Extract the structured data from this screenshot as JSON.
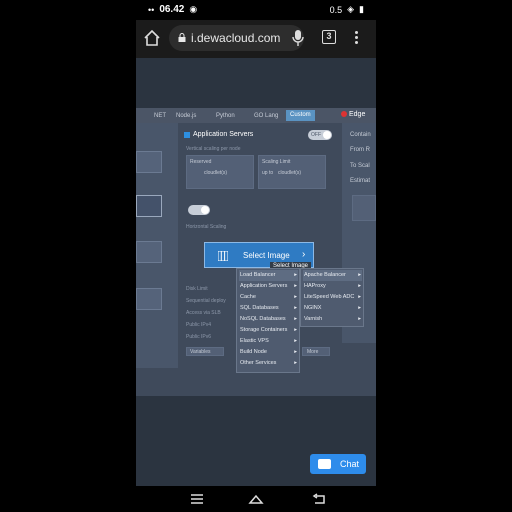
{
  "status": {
    "left_icons": "••",
    "time": "06.42",
    "right_text": "0.5"
  },
  "browser": {
    "url": "i.dewacloud.com",
    "tab_count": "3"
  },
  "stack_tabs": [
    "NET",
    "Node.js",
    "Python",
    "GO Lang",
    "Custom"
  ],
  "edge_label": "Edge",
  "panel": {
    "title": "Application Servers",
    "toggle": "OFF",
    "scaling_label": "Vertical scaling per node",
    "reserved": "Reserved",
    "scaling_limit": "Scaling Limit",
    "up_to": "up to",
    "cloudlets1": "cloudlet(s)",
    "cloudlets2": "cloudlet(s)",
    "horizontal": "Horizontal Scaling",
    "disk_limit": "Disk Limit",
    "seq_deploy": "Sequential deploy",
    "access_slb": "Access via SLB",
    "public_ipv4": "Public IPv4",
    "public_ipv6": "Public IPv6",
    "variables": "Variables",
    "more": "More"
  },
  "right_panel": [
    "Contain",
    "From R",
    "To Scal",
    "Estimat"
  ],
  "select_image": {
    "label": "Select Image",
    "tooltip": "Select Image"
  },
  "menu1": [
    "Load Balancer",
    "Application Servers",
    "Cache",
    "SQL Databases",
    "NoSQL Databases",
    "Storage Containers",
    "Elastic VPS",
    "Build Node",
    "Other Services"
  ],
  "menu2": [
    "Apache Balancer",
    "HAProxy",
    "LiteSpeed Web ADC",
    "NGINX",
    "Varnish"
  ],
  "chat": "Chat"
}
